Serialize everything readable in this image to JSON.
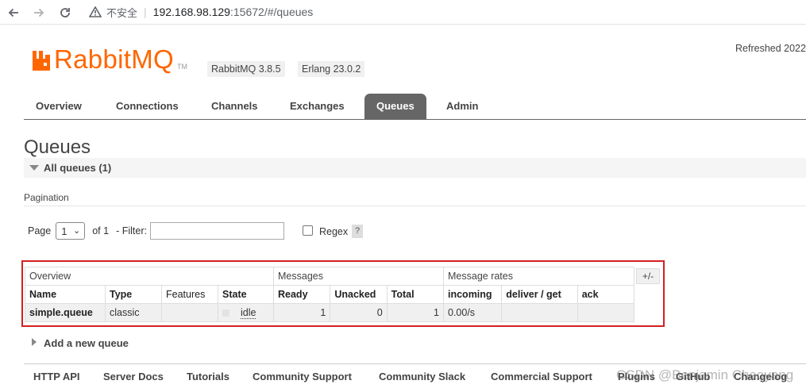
{
  "browser": {
    "insecure_label": "不安全",
    "url_host": "192.168.98.129",
    "url_port": ":15672",
    "url_path": "/#/queues"
  },
  "header": {
    "logo_text": "RabbitMQ",
    "logo_tm": "TM",
    "version_badge": "RabbitMQ 3.8.5",
    "erlang_badge": "Erlang 23.0.2",
    "refreshed": "Refreshed 2022"
  },
  "tabs": [
    {
      "label": "Overview"
    },
    {
      "label": "Connections"
    },
    {
      "label": "Channels"
    },
    {
      "label": "Exchanges"
    },
    {
      "label": "Queues",
      "active": true
    },
    {
      "label": "Admin"
    }
  ],
  "page": {
    "title": "Queues",
    "section": "All queues (1)",
    "pagination_label": "Pagination"
  },
  "pager": {
    "page_label": "Page",
    "page_value": "1",
    "of_label": "of 1",
    "filter_label": "- Filter:",
    "filter_value": "",
    "regex_label": "Regex",
    "help": "?"
  },
  "table": {
    "groups": [
      "Overview",
      "Messages",
      "Message rates"
    ],
    "toggle": "+/-",
    "columns": [
      "Name",
      "Type",
      "Features",
      "State",
      "Ready",
      "Unacked",
      "Total",
      "incoming",
      "deliver / get",
      "ack"
    ],
    "rows": [
      {
        "name": "simple.queue",
        "type": "classic",
        "features": "",
        "state": "idle",
        "ready": "1",
        "unacked": "0",
        "total": "1",
        "incoming": "0.00/s",
        "deliver_get": "",
        "ack": ""
      }
    ]
  },
  "add_queue": "Add a new queue",
  "footer": [
    "HTTP API",
    "Server Docs",
    "Tutorials",
    "Community Support",
    "Community Slack",
    "Commercial Support",
    "Plugins",
    "GitHub",
    "Changelog"
  ],
  "watermark": "CSDN @Benjamin Chaoyang",
  "colors": {
    "brand": "#ff6600",
    "highlight_frame": "#d32020",
    "active_tab": "#666666"
  }
}
